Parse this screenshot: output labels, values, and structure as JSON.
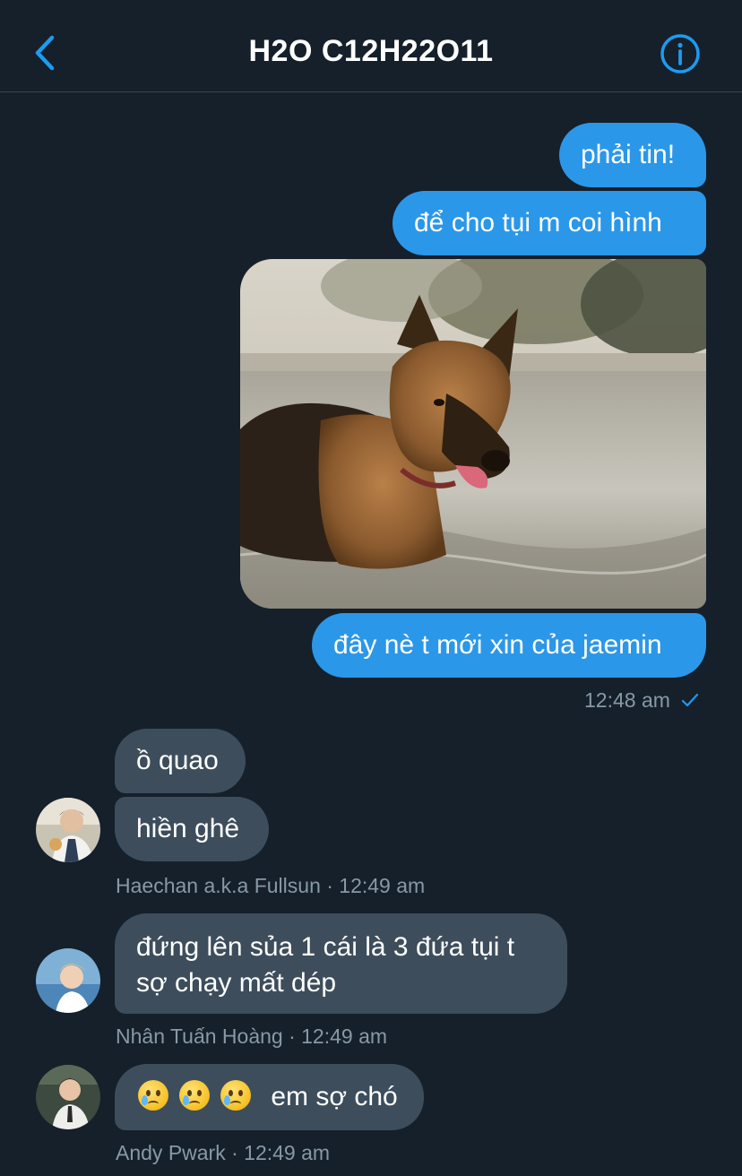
{
  "header": {
    "title": "H2O C12H22O11",
    "back_icon": "chevron-left-icon",
    "info_icon": "info-circle-icon"
  },
  "colors": {
    "background": "#15202b",
    "outgoing_bubble": "#2b97e8",
    "incoming_bubble": "#3d4d5c",
    "accent": "#1d9bf0",
    "meta_text": "#8899a6"
  },
  "outgoing": {
    "msg1": "phải tin!",
    "msg2": "để cho tụi m coi hình",
    "msg3": "đây nè t mới xin của jaemin",
    "time": "12:48 am",
    "read_icon": "checkmark-icon"
  },
  "thread": [
    {
      "sender": "Haechan a.k.a Fullsun",
      "messages": [
        "ồ quao",
        "hiền ghê"
      ],
      "meta": "Haechan a.k.a Fullsun · 12:49 am"
    },
    {
      "sender": "Nhân Tuấn Hoàng",
      "lines": [
        "đứng lên sủa 1 cái là 3 đứa tụi t",
        "sợ chạy mất dép"
      ],
      "meta": "Nhân Tuấn Hoàng · 12:49 am"
    },
    {
      "sender": "Andy Pwark",
      "text": "em sợ chó",
      "emoji": "crying-face-icon",
      "meta": "Andy Pwark · 12:49 am"
    }
  ]
}
